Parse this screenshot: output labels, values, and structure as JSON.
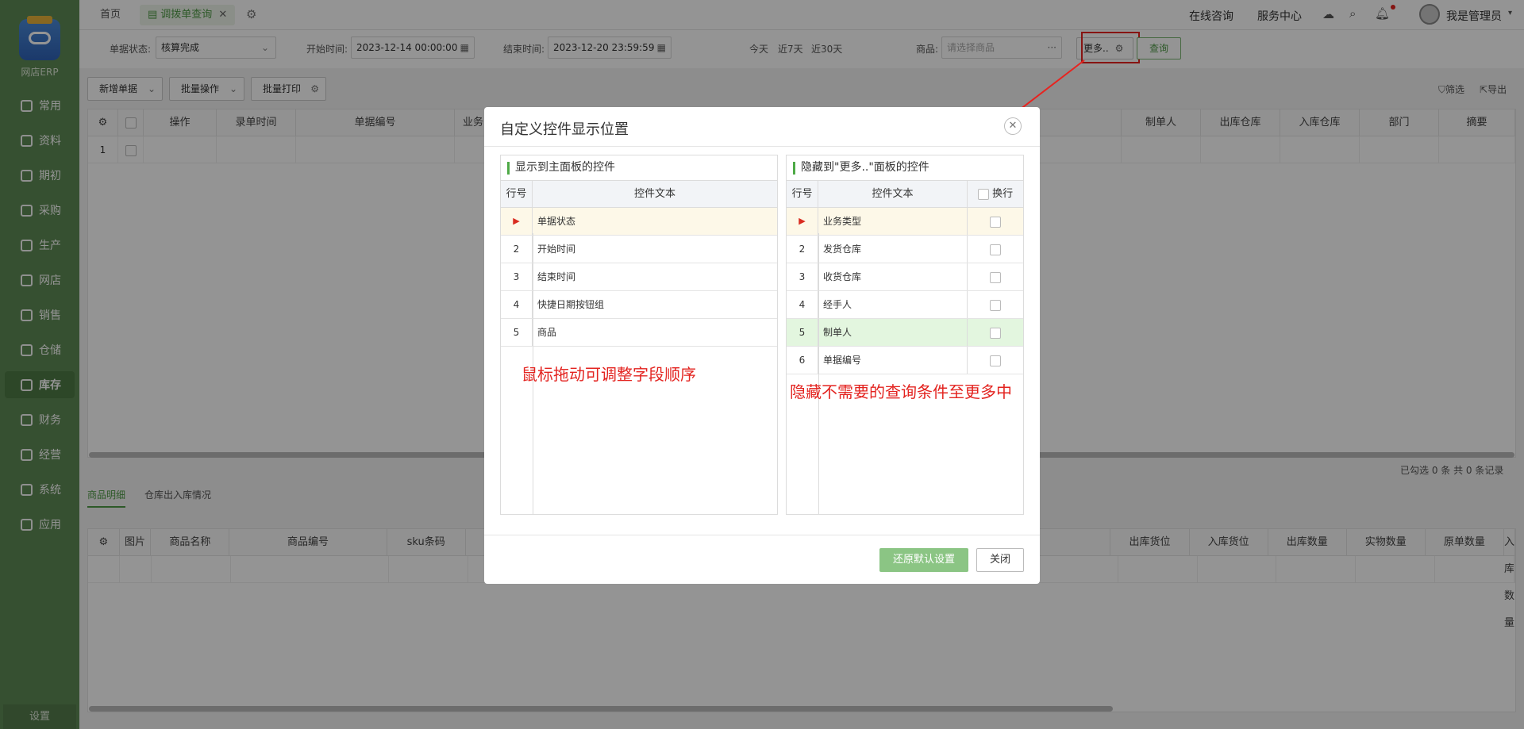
{
  "sidebar": {
    "brand": "网店ERP",
    "items": [
      {
        "label": "常用",
        "icon": "star-icon"
      },
      {
        "label": "资料",
        "icon": "document-icon"
      },
      {
        "label": "期初",
        "icon": "clock-icon"
      },
      {
        "label": "采购",
        "icon": "cart-icon"
      },
      {
        "label": "生产",
        "icon": "factory-icon"
      },
      {
        "label": "网店",
        "icon": "shop-icon"
      },
      {
        "label": "销售",
        "icon": "chart-icon"
      },
      {
        "label": "仓储",
        "icon": "warehouse-icon"
      },
      {
        "label": "库存",
        "icon": "home-icon"
      },
      {
        "label": "财务",
        "icon": "wallet-icon"
      },
      {
        "label": "经营",
        "icon": "trend-icon"
      },
      {
        "label": "系统",
        "icon": "gear-icon"
      },
      {
        "label": "应用",
        "icon": "plus-icon"
      }
    ],
    "active_index": 8,
    "settings": "设置"
  },
  "topbar": {
    "home_tab": "首页",
    "active_tab": "调拨单查询",
    "links": [
      "在线咨询",
      "服务中心"
    ],
    "user": "我是管理员"
  },
  "filters": {
    "status_label": "单据状态:",
    "status_value": "核算完成",
    "start_label": "开始时间:",
    "start_value": "2023-12-14 00:00:00",
    "end_label": "结束时间:",
    "end_value": "2023-12-20 23:59:59",
    "quick": [
      "今天",
      "近7天",
      "近30天"
    ],
    "product_label": "商品:",
    "product_placeholder": "请选择商品",
    "more": "更多..",
    "query": "查询"
  },
  "toolbar": {
    "new": "新增单据",
    "batch": "批量操作",
    "print": "批量打印",
    "filter": "筛选",
    "export": "导出"
  },
  "main_grid": {
    "headers": [
      "操作",
      "录单时间",
      "单据编号",
      "业务",
      "制单人",
      "出库仓库",
      "入库仓库",
      "部门",
      "摘要"
    ],
    "row_no": "1",
    "summary": "已勾选 0 条 共 0 条记录"
  },
  "bottom_tabs": [
    "商品明细",
    "仓库出入库情况"
  ],
  "detail_grid": {
    "headers": [
      "图片",
      "商品名称",
      "商品编号",
      "sku条码",
      "出库货位",
      "入库货位",
      "出库数量",
      "实物数量",
      "原单数量",
      "入库数量"
    ]
  },
  "dialog": {
    "title": "自定义控件显示位置",
    "left_title": "显示到主面板的控件",
    "right_title": "隐藏到\"更多..\"面板的控件",
    "col_no": "行号",
    "col_text": "控件文本",
    "col_wrap": "换行",
    "left_rows": [
      "单据状态",
      "开始时间",
      "结束时间",
      "快捷日期按钮组",
      "商品"
    ],
    "left_nos": [
      "",
      "2",
      "3",
      "4",
      "5"
    ],
    "right_rows": [
      "业务类型",
      "发货仓库",
      "收货仓库",
      "经手人",
      "制单人",
      "单据编号"
    ],
    "right_nos": [
      "",
      "2",
      "3",
      "4",
      "5",
      "6"
    ],
    "note_left": "鼠标拖动可调整字段顺序",
    "note_right": "隐藏不需要的查询条件至更多中",
    "restore": "还原默认设置",
    "close": "关闭"
  }
}
